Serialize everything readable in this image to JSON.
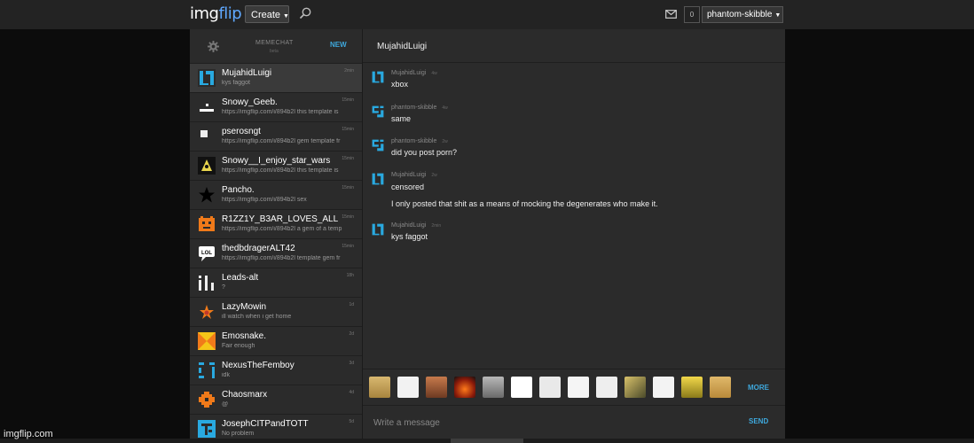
{
  "topbar": {
    "logo_main": "img",
    "logo_accent": "flip",
    "create_label": "Create",
    "notif_count": "0",
    "username": "phantom-skibble",
    "icons": [
      "search-icon",
      "mail-icon",
      "caret-down-icon"
    ]
  },
  "sidebar": {
    "title": "MEMECHAT",
    "beta": "beta",
    "new_label": "NEW",
    "items": [
      {
        "name": "MujahidLuigi",
        "preview": "kys faggot",
        "time": "2min"
      },
      {
        "name": "Snowy_Geeb.",
        "preview": "https://imgflip.com/i/894b2l this template is",
        "time": "15min"
      },
      {
        "name": "pserosngt",
        "preview": "https://imgflip.com/i/894b2l gem template fr",
        "time": "15min"
      },
      {
        "name": "Snowy__I_enjoy_star_wars",
        "preview": "https://imgflip.com/i/894b2l this template is",
        "time": "15min"
      },
      {
        "name": "Pancho.",
        "preview": "https://imgflip.com/i/894b2l sex",
        "time": "15min"
      },
      {
        "name": "R1ZZ1Y_B3AR_LOVES_ALL",
        "preview": "https://imgflip.com/i/894b2l a gem of a temp",
        "time": "15min"
      },
      {
        "name": "thedbdragerALT42",
        "preview": "https://imgflip.com/i/894b2l template gem fr",
        "time": "15min"
      },
      {
        "name": "Leads-alt",
        "preview": "?",
        "time": "18h"
      },
      {
        "name": "LazyMowin",
        "preview": "ill watch when i get home",
        "time": "1d"
      },
      {
        "name": "Emosnake.",
        "preview": "Fair enough",
        "time": "2d"
      },
      {
        "name": "NexusTheFemboy",
        "preview": "idk",
        "time": "3d"
      },
      {
        "name": "Chaosmarx",
        "preview": "@",
        "time": "4d"
      },
      {
        "name": "JosephCITPandTOTT",
        "preview": "No problem",
        "time": "5d"
      }
    ]
  },
  "chat": {
    "title": "MujahidLuigi",
    "messages": [
      {
        "user": "MujahidLuigi",
        "time": "4w",
        "lines": [
          "xbox"
        ]
      },
      {
        "user": "phantom-skibble",
        "time": "4w",
        "lines": [
          "same"
        ]
      },
      {
        "user": "phantom-skibble",
        "time": "2w",
        "lines": [
          "did you post porn?"
        ]
      },
      {
        "user": "MujahidLuigi",
        "time": "2w",
        "lines": [
          "censored",
          "I only posted that shit as a means of mocking the degenerates who make it."
        ]
      },
      {
        "user": "MujahidLuigi",
        "time": "2min",
        "lines": [
          "kys faggot"
        ]
      }
    ],
    "more_label": "MORE",
    "composer_placeholder": "Write a message",
    "send_label": "SEND",
    "stickers": [
      "doge-face",
      "trollface",
      "jesus-photo",
      "explosion",
      "stone-tablet",
      "forever-alone",
      "rage-face",
      "cereal-guy",
      "okay-guy",
      "chart-meme",
      "spongebob",
      "yellow-face",
      "doge-face-2"
    ]
  },
  "watermark": "imgflip.com"
}
